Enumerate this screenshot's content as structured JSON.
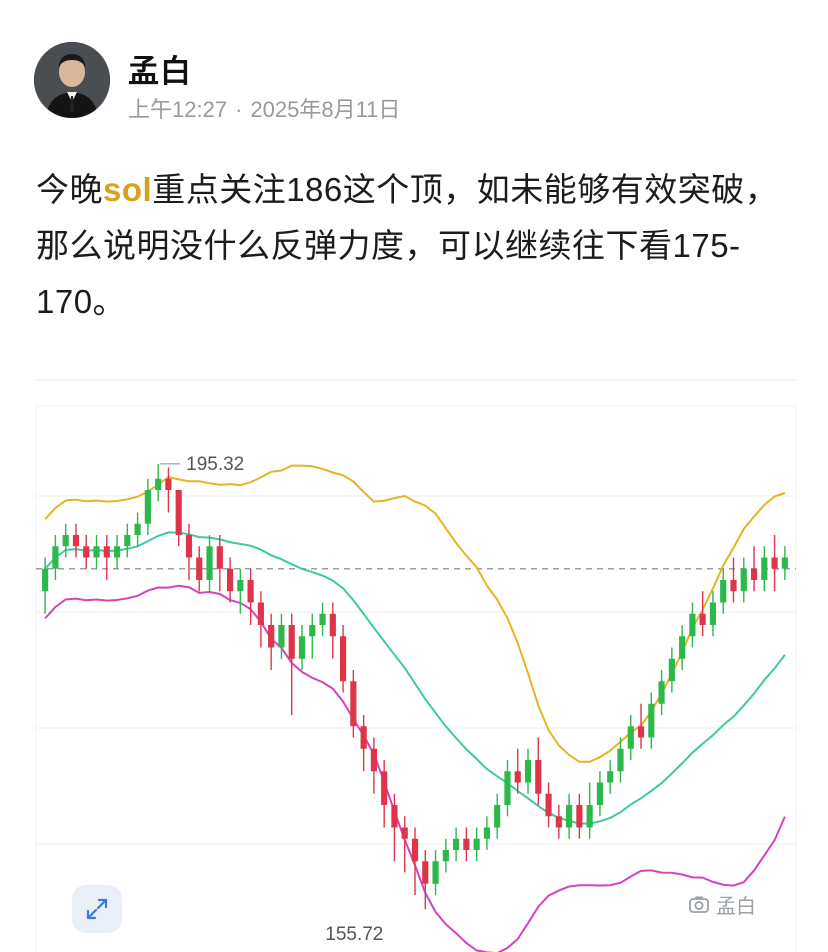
{
  "author": {
    "name": "孟白",
    "time": "上午12:27",
    "separator": "·",
    "date": "2025年8月11日"
  },
  "post": {
    "text_before": "今晚",
    "highlight": "sol",
    "text_after": "重点关注186这个顶，如未能够有效突破，那么说明没什么反弹力度，可以继续往下看175-170。"
  },
  "chart": {
    "label_high": "195.32",
    "label_low": "155.72",
    "watermark": "孟白",
    "expand_icon": "expand-icon",
    "colors": {
      "up": "#2db84b",
      "down": "#e0344a",
      "upper_band": "#e6b422",
      "middle_band": "#3cc9a3",
      "lower_band": "#d443c0",
      "price_line": "#9e9e9e",
      "grid": "#ececec"
    }
  },
  "chart_data": {
    "type": "candlestick",
    "high_label": 195.32,
    "low_label": 155.72,
    "current_price_line": 186,
    "candles": [
      [
        184,
        186,
        182,
        187
      ],
      [
        186,
        188,
        185,
        189
      ],
      [
        188,
        189,
        187,
        190
      ],
      [
        189,
        188,
        187,
        190
      ],
      [
        188,
        187,
        186,
        189
      ],
      [
        187,
        188,
        186,
        189
      ],
      [
        188,
        187,
        185,
        189
      ],
      [
        187,
        188,
        186,
        189
      ],
      [
        188,
        189,
        187,
        190
      ],
      [
        189,
        190,
        188,
        191
      ],
      [
        190,
        193,
        189,
        194
      ],
      [
        193,
        194,
        192,
        195.32
      ],
      [
        194,
        193,
        191,
        195
      ],
      [
        193,
        189,
        188,
        193
      ],
      [
        189,
        187,
        185,
        190
      ],
      [
        187,
        185,
        184,
        188
      ],
      [
        185,
        188,
        184,
        189
      ],
      [
        188,
        186,
        184,
        189
      ],
      [
        186,
        184,
        183,
        187
      ],
      [
        184,
        185,
        182,
        186
      ],
      [
        185,
        183,
        181,
        186
      ],
      [
        183,
        181,
        179,
        184
      ],
      [
        181,
        179,
        177,
        182
      ],
      [
        179,
        181,
        178,
        182
      ],
      [
        181,
        178,
        173,
        182
      ],
      [
        178,
        180,
        177,
        181
      ],
      [
        180,
        181,
        178,
        182
      ],
      [
        181,
        182,
        180,
        183
      ],
      [
        182,
        180,
        178,
        183
      ],
      [
        180,
        176,
        175,
        181
      ],
      [
        176,
        172,
        171,
        177
      ],
      [
        172,
        170,
        168,
        173
      ],
      [
        170,
        168,
        166,
        171
      ],
      [
        168,
        165,
        163,
        169
      ],
      [
        165,
        163,
        160,
        166
      ],
      [
        163,
        162,
        159,
        164
      ],
      [
        162,
        160,
        157,
        163
      ],
      [
        160,
        158,
        155.72,
        161
      ],
      [
        158,
        160,
        157,
        161
      ],
      [
        160,
        161,
        159,
        162
      ],
      [
        161,
        162,
        160,
        163
      ],
      [
        162,
        161,
        160,
        163
      ],
      [
        161,
        162,
        160,
        163
      ],
      [
        162,
        163,
        161,
        164
      ],
      [
        163,
        165,
        162,
        166
      ],
      [
        165,
        168,
        164,
        169
      ],
      [
        168,
        167,
        166,
        170
      ],
      [
        167,
        169,
        166,
        170
      ],
      [
        169,
        166,
        165,
        171
      ],
      [
        166,
        164,
        163,
        167
      ],
      [
        164,
        163,
        162,
        165
      ],
      [
        163,
        165,
        162,
        166
      ],
      [
        165,
        163,
        162,
        166
      ],
      [
        163,
        165,
        162,
        167
      ],
      [
        165,
        167,
        164,
        168
      ],
      [
        167,
        168,
        166,
        169
      ],
      [
        168,
        170,
        167,
        171
      ],
      [
        170,
        172,
        169,
        173
      ],
      [
        172,
        171,
        170,
        174
      ],
      [
        171,
        174,
        170,
        175
      ],
      [
        174,
        176,
        173,
        177
      ],
      [
        176,
        178,
        175,
        179
      ],
      [
        178,
        180,
        177,
        181
      ],
      [
        180,
        182,
        179,
        183
      ],
      [
        182,
        181,
        180,
        184
      ],
      [
        181,
        183,
        180,
        184
      ],
      [
        183,
        185,
        182,
        186
      ],
      [
        185,
        184,
        183,
        187
      ],
      [
        184,
        186,
        183,
        187
      ],
      [
        186,
        185,
        184,
        188
      ],
      [
        185,
        187,
        184,
        188
      ],
      [
        187,
        186,
        184,
        189
      ],
      [
        186,
        187,
        185,
        188
      ]
    ]
  }
}
